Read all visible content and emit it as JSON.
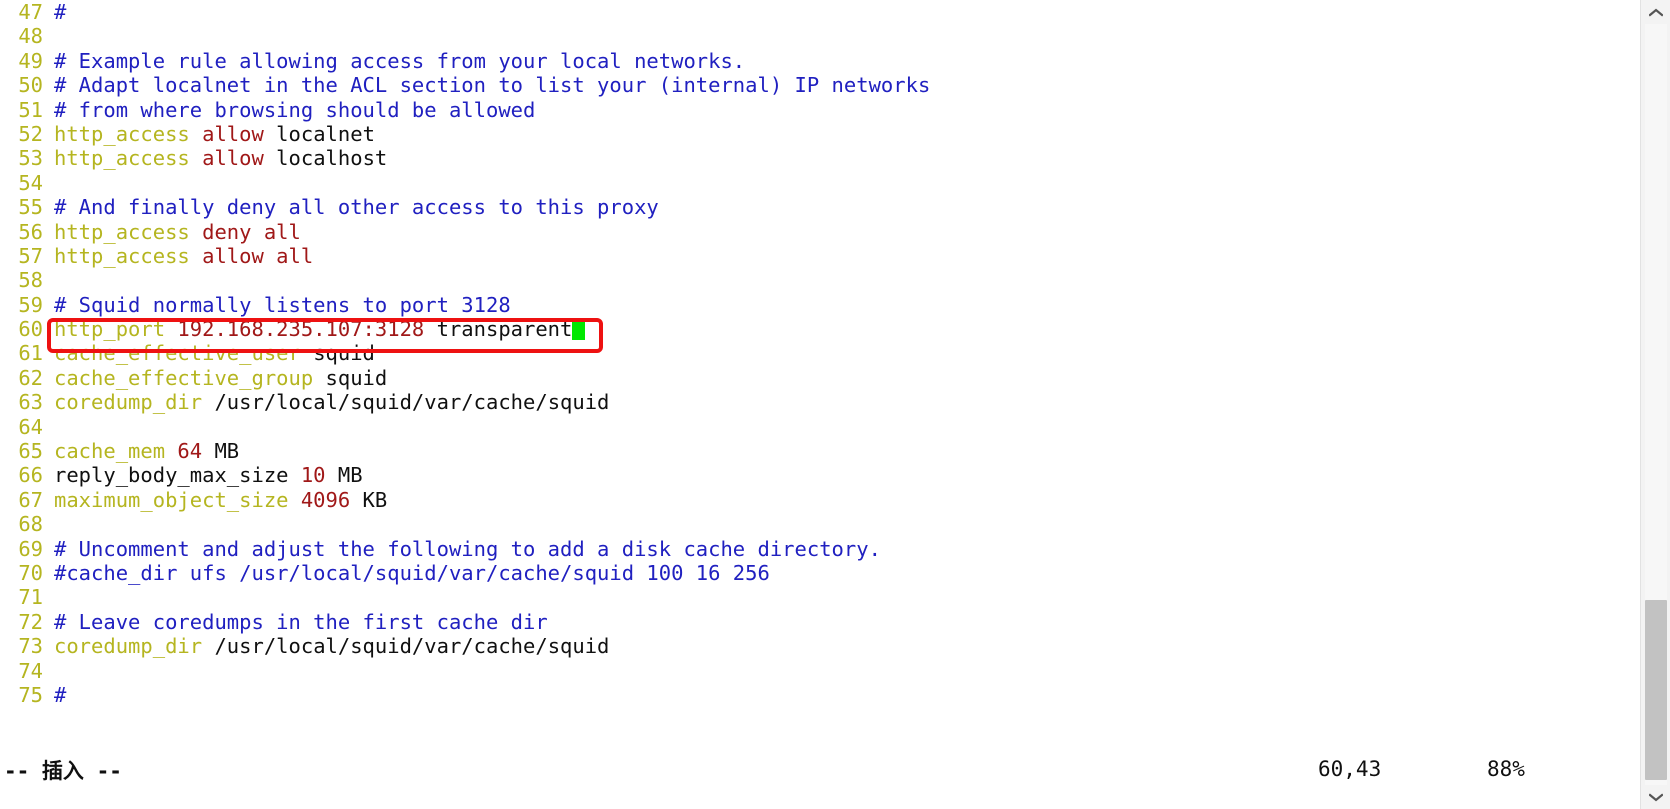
{
  "editor": {
    "app": "vim",
    "file_type": "squid-config",
    "first_visible_line": 47,
    "cursor": {
      "line": 60,
      "column": 43,
      "style": "block",
      "color": "#00e800"
    },
    "lines": [
      {
        "num": 47,
        "tokens": [
          {
            "text": "#",
            "style": "comment"
          }
        ]
      },
      {
        "num": 48,
        "tokens": []
      },
      {
        "num": 49,
        "tokens": [
          {
            "text": "# Example rule allowing access from your local networks.",
            "style": "comment"
          }
        ]
      },
      {
        "num": 50,
        "tokens": [
          {
            "text": "# Adapt localnet in the ACL section to list your (internal) IP networks",
            "style": "comment"
          }
        ]
      },
      {
        "num": 51,
        "tokens": [
          {
            "text": "# from where browsing should be allowed",
            "style": "comment"
          }
        ]
      },
      {
        "num": 52,
        "tokens": [
          {
            "text": "http_access ",
            "style": "kw"
          },
          {
            "text": "allow",
            "style": "action"
          },
          {
            "text": " localnet",
            "style": "plain"
          }
        ]
      },
      {
        "num": 53,
        "tokens": [
          {
            "text": "http_access ",
            "style": "kw"
          },
          {
            "text": "allow",
            "style": "action"
          },
          {
            "text": " localhost",
            "style": "plain"
          }
        ]
      },
      {
        "num": 54,
        "tokens": []
      },
      {
        "num": 55,
        "tokens": [
          {
            "text": "# And finally deny all other access to this proxy",
            "style": "comment"
          }
        ]
      },
      {
        "num": 56,
        "tokens": [
          {
            "text": "http_access ",
            "style": "kw"
          },
          {
            "text": "deny all",
            "style": "action"
          }
        ]
      },
      {
        "num": 57,
        "tokens": [
          {
            "text": "http_access ",
            "style": "kw"
          },
          {
            "text": "allow all",
            "style": "action"
          }
        ]
      },
      {
        "num": 58,
        "tokens": []
      },
      {
        "num": 59,
        "tokens": [
          {
            "text": "# Squid normally listens to port 3128",
            "style": "comment"
          }
        ]
      },
      {
        "num": 60,
        "tokens": [
          {
            "text": "http_port ",
            "style": "kw"
          },
          {
            "text": "192.168.235.107:3128",
            "style": "num"
          },
          {
            "text": " transparent",
            "style": "plain"
          }
        ],
        "cursor_after": true,
        "highlighted": true
      },
      {
        "num": 61,
        "tokens": [
          {
            "text": "cache_effective_user ",
            "style": "kw"
          },
          {
            "text": "squid",
            "style": "plain"
          }
        ]
      },
      {
        "num": 62,
        "tokens": [
          {
            "text": "cache_effective_group ",
            "style": "kw"
          },
          {
            "text": "squid",
            "style": "plain"
          }
        ]
      },
      {
        "num": 63,
        "tokens": [
          {
            "text": "coredump_dir ",
            "style": "kw"
          },
          {
            "text": "/usr/local/squid/var/cache/squid",
            "style": "plain"
          }
        ]
      },
      {
        "num": 64,
        "tokens": []
      },
      {
        "num": 65,
        "tokens": [
          {
            "text": "cache_mem ",
            "style": "kw"
          },
          {
            "text": "64",
            "style": "num"
          },
          {
            "text": " MB",
            "style": "plain"
          }
        ]
      },
      {
        "num": 66,
        "tokens": [
          {
            "text": "reply_body_max_size ",
            "style": "plain"
          },
          {
            "text": "10",
            "style": "num"
          },
          {
            "text": " MB",
            "style": "plain"
          }
        ]
      },
      {
        "num": 67,
        "tokens": [
          {
            "text": "maximum_object_size ",
            "style": "kw"
          },
          {
            "text": "4096",
            "style": "num"
          },
          {
            "text": " KB",
            "style": "plain"
          }
        ]
      },
      {
        "num": 68,
        "tokens": []
      },
      {
        "num": 69,
        "tokens": [
          {
            "text": "# Uncomment and adjust the following to add a disk cache directory.",
            "style": "comment"
          }
        ]
      },
      {
        "num": 70,
        "tokens": [
          {
            "text": "#cache_dir ufs /usr/local/squid/var/cache/squid 100 16 256",
            "style": "comment"
          }
        ]
      },
      {
        "num": 71,
        "tokens": []
      },
      {
        "num": 72,
        "tokens": [
          {
            "text": "# Leave coredumps in the first cache dir",
            "style": "comment"
          }
        ]
      },
      {
        "num": 73,
        "tokens": [
          {
            "text": "coredump_dir ",
            "style": "kw"
          },
          {
            "text": "/usr/local/squid/var/cache/squid",
            "style": "plain"
          }
        ]
      },
      {
        "num": 74,
        "tokens": []
      },
      {
        "num": 75,
        "tokens": [
          {
            "text": "#",
            "style": "comment"
          }
        ]
      }
    ]
  },
  "annotation": {
    "shape": "rectangle",
    "color": "#ee1111",
    "target_line": 60,
    "target_text": "http_port 192.168.235.107:3128 transparent"
  },
  "statusbar": {
    "mode": "-- 插入 --",
    "position": "60,43",
    "percent": "88%"
  },
  "scrollbar": {
    "up_arrow": "chevron-up-icon",
    "down_arrow": "chevron-down-icon",
    "thumb_color": "#c2c2c2",
    "track_color": "#f3f3f3"
  },
  "colors": {
    "background": "#ffffff",
    "line_number": "#b5b520",
    "comment": "#2020c0",
    "keyword": "#b5b520",
    "action": "#a01818",
    "number": "#a01818",
    "plain": "#101010",
    "cursor": "#00e800",
    "annotation": "#ee1111"
  }
}
